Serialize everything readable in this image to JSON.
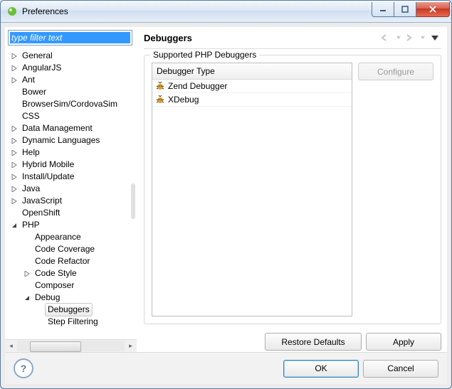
{
  "window": {
    "title": "Preferences"
  },
  "filter": {
    "placeholder": "type filter text"
  },
  "tree": {
    "items": [
      {
        "label": "General",
        "depth": 0,
        "arrow": "closed"
      },
      {
        "label": "AngularJS",
        "depth": 0,
        "arrow": "closed"
      },
      {
        "label": "Ant",
        "depth": 0,
        "arrow": "closed"
      },
      {
        "label": "Bower",
        "depth": 0,
        "arrow": "none"
      },
      {
        "label": "BrowserSim/CordovaSim",
        "depth": 0,
        "arrow": "none"
      },
      {
        "label": "CSS",
        "depth": 0,
        "arrow": "none"
      },
      {
        "label": "Data Management",
        "depth": 0,
        "arrow": "closed"
      },
      {
        "label": "Dynamic Languages",
        "depth": 0,
        "arrow": "closed"
      },
      {
        "label": "Help",
        "depth": 0,
        "arrow": "closed"
      },
      {
        "label": "Hybrid Mobile",
        "depth": 0,
        "arrow": "closed"
      },
      {
        "label": "Install/Update",
        "depth": 0,
        "arrow": "closed"
      },
      {
        "label": "Java",
        "depth": 0,
        "arrow": "closed"
      },
      {
        "label": "JavaScript",
        "depth": 0,
        "arrow": "closed"
      },
      {
        "label": "OpenShift",
        "depth": 0,
        "arrow": "none"
      },
      {
        "label": "PHP",
        "depth": 0,
        "arrow": "open"
      },
      {
        "label": "Appearance",
        "depth": 1,
        "arrow": "none"
      },
      {
        "label": "Code Coverage",
        "depth": 1,
        "arrow": "none"
      },
      {
        "label": "Code Refactor",
        "depth": 1,
        "arrow": "none"
      },
      {
        "label": "Code Style",
        "depth": 1,
        "arrow": "closed"
      },
      {
        "label": "Composer",
        "depth": 1,
        "arrow": "none"
      },
      {
        "label": "Debug",
        "depth": 1,
        "arrow": "open"
      },
      {
        "label": "Debuggers",
        "depth": 2,
        "arrow": "none",
        "selected": true
      },
      {
        "label": "Step Filtering",
        "depth": 2,
        "arrow": "none"
      }
    ]
  },
  "page": {
    "title": "Debuggers",
    "group_label": "Supported PHP Debuggers",
    "column_header": "Debugger Type",
    "debuggers": [
      {
        "name": "Zend Debugger"
      },
      {
        "name": "XDebug"
      }
    ],
    "configure_label": "Configure"
  },
  "buttons": {
    "restore_defaults": "Restore Defaults",
    "apply": "Apply",
    "ok": "OK",
    "cancel": "Cancel"
  }
}
